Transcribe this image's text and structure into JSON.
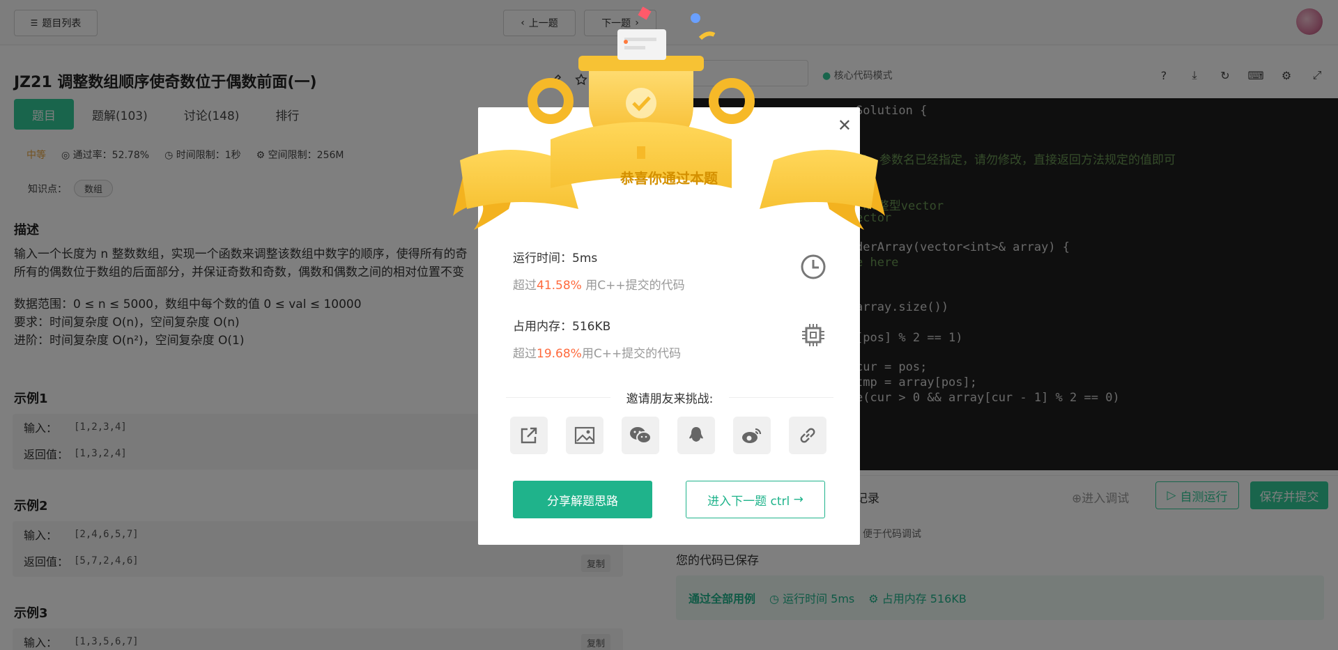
{
  "topbar": {
    "problem_list": "题目列表",
    "prev": "上一题",
    "next": "下一题"
  },
  "problem": {
    "title": "JZ21  调整数组顺序使奇数位于偶数前面(一)",
    "tabs": [
      "题目",
      "题解(103)",
      "讨论(148)",
      "排行"
    ],
    "difficulty": "中等",
    "pass_rate": "通过率：52.78%",
    "time_limit": "时间限制：1秒",
    "space_limit": "空间限制：256M",
    "knowledge_label": "知识点：",
    "knowledge_tag": "数组",
    "desc_heading": "描述",
    "desc_line1": "输入一个长度为 n 整数数组，实现一个函数来调整该数组中数字的顺序，使得所有的奇",
    "desc_line2": "所有的偶数位于数组的后面部分，并保证奇数和奇数，偶数和偶数之间的相对位置不变",
    "range_line": "数据范围：0 ≤ n ≤ 5000，数组中每个数的值 0 ≤ val ≤ 10000",
    "req_line": "要求：时间复杂度 O(n)，空间复杂度 O(n)",
    "adv_line": "进阶：时间复杂度 O(n²)，空间复杂度 O(1)",
    "examples": [
      {
        "heading": "示例1",
        "input_label": "输入：",
        "input": "[1,2,3,4]",
        "output_label": "返回值：",
        "output": "[1,3,2,4]"
      },
      {
        "heading": "示例2",
        "input_label": "输入：",
        "input": "[2,4,6,5,7]",
        "output_label": "返回值：",
        "output": "[5,7,2,4,6]",
        "copy": "复制"
      },
      {
        "heading": "示例3",
        "input_label": "输入：",
        "input": "[1,3,5,6,7]",
        "copy": "复制"
      }
    ]
  },
  "editor": {
    "mode": "核心代码模式",
    "lines": [
      "Solution {",
      "",
      "名、参数名已经指定，请勿修改，直接返回方法规定的值即可",
      "",
      "int整型vector",
      "ector",
      "",
      "derArray(vector<int>& array) {",
      "e here",
      "",
      "",
      "array.size())",
      "",
      "[pos] % 2 == 1)",
      "",
      "cur = pos;",
      "tmp = array[pos];",
      "e(cur > 0 && array[cur - 1] % 2 == 0)"
    ]
  },
  "runbar": {
    "record_suffix": "记录",
    "debug": "进入调试",
    "self_test": "自测运行",
    "submit": "保存并提交",
    "debug_hint": "便于代码调试",
    "saved": "您的代码已保存",
    "passed": "通过全部用例",
    "runtime": "运行时间 5ms",
    "memory": "占用内存 516KB"
  },
  "modal": {
    "banner": "恭喜你通过本题",
    "runtime_label": "运行时间：5ms",
    "runtime_prefix": "超过",
    "runtime_pct": "41.58%",
    "runtime_suffix": " 用C++提交的代码",
    "memory_label": "占用内存：516KB",
    "memory_prefix": "超过",
    "memory_pct": "19.68%",
    "memory_suffix": "用C++提交的代码",
    "invite": "邀请朋友来挑战:",
    "share_btn": "分享解题思路",
    "next_btn": "进入下一题 ctrl"
  },
  "colors": {
    "brand": "#32ca99",
    "modal_btn": "#1fb38b",
    "highlight": "#ff6a3d",
    "gold": "#f7c234"
  }
}
